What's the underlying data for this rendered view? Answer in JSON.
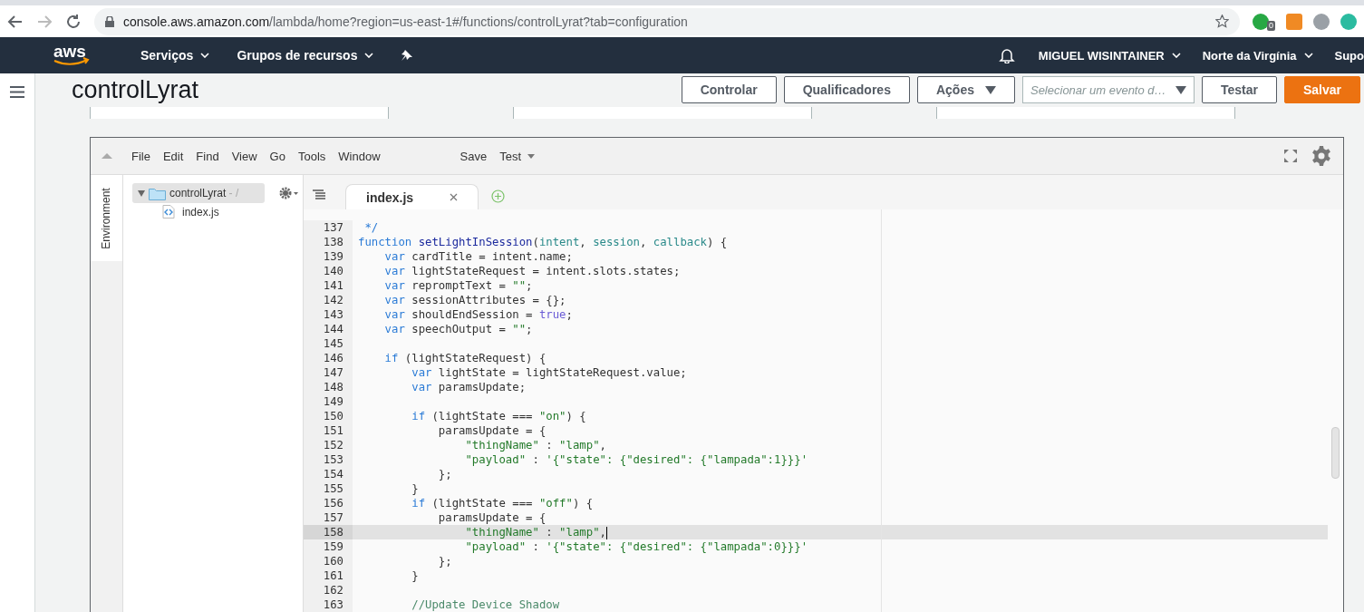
{
  "browser": {
    "url_host": "console.aws.amazon.com",
    "url_path": "/lambda/home?region=us-east-1#/functions/controlLyrat?tab=configuration",
    "extension_badge": "0"
  },
  "nav": {
    "logo": "aws",
    "items": [
      {
        "label": "Serviços"
      },
      {
        "label": "Grupos de recursos"
      }
    ],
    "user": "MIGUEL WISINTAINER",
    "region": "Norte da Virgínia",
    "support": "Supo"
  },
  "header": {
    "title": "controlLyrat",
    "buttons": [
      {
        "kind": "plain",
        "label": "Controlar"
      },
      {
        "kind": "plain",
        "label": "Qualificadores"
      },
      {
        "kind": "dropdown",
        "label": "Ações"
      },
      {
        "kind": "select",
        "placeholder": "Selecionar um evento d…"
      },
      {
        "kind": "plain",
        "label": "Testar"
      },
      {
        "kind": "primary",
        "label": "Salvar"
      }
    ]
  },
  "ide": {
    "menu": [
      "File",
      "Edit",
      "Find",
      "View",
      "Go",
      "Tools",
      "Window"
    ],
    "save": "Save",
    "test": "Test",
    "side_tab": "Environment",
    "tree": {
      "label": "controlLyrat",
      "suffix": "- /",
      "expanded": true,
      "children": [
        {
          "label": "index.js"
        }
      ]
    },
    "tabs": [
      {
        "label": "index.js",
        "selected": true
      }
    ],
    "lines": [
      {
        "number": "137",
        "current": false,
        "tokens": [
          {
            "kind": "comment",
            "text": " */"
          }
        ]
      },
      {
        "number": "138",
        "current": false,
        "tokens": [
          {
            "kind": "keyword",
            "text": "function "
          },
          {
            "kind": "func",
            "text": "setLightInSession"
          },
          {
            "kind": "plain",
            "text": "("
          },
          {
            "kind": "param",
            "text": "intent"
          },
          {
            "kind": "plain",
            "text": ", "
          },
          {
            "kind": "param",
            "text": "session"
          },
          {
            "kind": "plain",
            "text": ", "
          },
          {
            "kind": "param",
            "text": "callback"
          },
          {
            "kind": "plain",
            "text": ") {"
          }
        ]
      },
      {
        "number": "139",
        "current": false,
        "tokens": [
          {
            "kind": "keyword",
            "text": "    var "
          },
          {
            "kind": "plain",
            "text": "cardTitle = intent.name;"
          }
        ]
      },
      {
        "number": "140",
        "current": false,
        "tokens": [
          {
            "kind": "keyword",
            "text": "    var "
          },
          {
            "kind": "plain",
            "text": "lightStateRequest = intent.slots.states;"
          }
        ]
      },
      {
        "number": "141",
        "current": false,
        "tokens": [
          {
            "kind": "keyword",
            "text": "    var "
          },
          {
            "kind": "plain",
            "text": "repromptText = "
          },
          {
            "kind": "string",
            "text": "\"\""
          },
          {
            "kind": "plain",
            "text": ";"
          }
        ]
      },
      {
        "number": "142",
        "current": false,
        "tokens": [
          {
            "kind": "keyword",
            "text": "    var "
          },
          {
            "kind": "plain",
            "text": "sessionAttributes = {};"
          }
        ]
      },
      {
        "number": "143",
        "current": false,
        "tokens": [
          {
            "kind": "keyword",
            "text": "    var "
          },
          {
            "kind": "plain",
            "text": "shouldEndSession = "
          },
          {
            "kind": "literal",
            "text": "true"
          },
          {
            "kind": "plain",
            "text": ";"
          }
        ]
      },
      {
        "number": "144",
        "current": false,
        "tokens": [
          {
            "kind": "keyword",
            "text": "    var "
          },
          {
            "kind": "plain",
            "text": "speechOutput = "
          },
          {
            "kind": "string",
            "text": "\"\""
          },
          {
            "kind": "plain",
            "text": ";"
          }
        ]
      },
      {
        "number": "145",
        "current": false
      },
      {
        "number": "146",
        "current": false,
        "tokens": [
          {
            "kind": "keyword",
            "text": "    if "
          },
          {
            "kind": "plain",
            "text": "(lightStateRequest) {"
          }
        ]
      },
      {
        "number": "147",
        "current": false,
        "tokens": [
          {
            "kind": "keyword",
            "text": "        var "
          },
          {
            "kind": "plain",
            "text": "lightState = lightStateRequest.value;"
          }
        ]
      },
      {
        "number": "148",
        "current": false,
        "tokens": [
          {
            "kind": "keyword",
            "text": "        var "
          },
          {
            "kind": "plain",
            "text": "paramsUpdate;"
          }
        ]
      },
      {
        "number": "149",
        "current": false
      },
      {
        "number": "150",
        "current": false,
        "tokens": [
          {
            "kind": "keyword",
            "text": "        if "
          },
          {
            "kind": "plain",
            "text": "(lightState === "
          },
          {
            "kind": "string",
            "text": "\"on\""
          },
          {
            "kind": "plain",
            "text": ") {"
          }
        ]
      },
      {
        "number": "151",
        "current": false,
        "tokens": [
          {
            "kind": "plain",
            "text": "            paramsUpdate = {"
          }
        ]
      },
      {
        "number": "152",
        "current": false,
        "tokens": [
          {
            "kind": "string",
            "text": "                \"thingName\""
          },
          {
            "kind": "plain",
            "text": " : "
          },
          {
            "kind": "string",
            "text": "\"lamp\""
          },
          {
            "kind": "plain",
            "text": ","
          }
        ]
      },
      {
        "number": "153",
        "current": false,
        "tokens": [
          {
            "kind": "string",
            "text": "                \"payload\""
          },
          {
            "kind": "plain",
            "text": " : "
          },
          {
            "kind": "string",
            "text": "'{\"state\": {\"desired\": {\"lampada\":1}}}'"
          }
        ]
      },
      {
        "number": "154",
        "current": false,
        "tokens": [
          {
            "kind": "plain",
            "text": "            };"
          }
        ]
      },
      {
        "number": "155",
        "current": false,
        "tokens": [
          {
            "kind": "plain",
            "text": "        }"
          }
        ]
      },
      {
        "number": "156",
        "current": false,
        "tokens": [
          {
            "kind": "keyword",
            "text": "        if "
          },
          {
            "kind": "plain",
            "text": "(lightState === "
          },
          {
            "kind": "string",
            "text": "\"off\""
          },
          {
            "kind": "plain",
            "text": ") {"
          }
        ]
      },
      {
        "number": "157",
        "current": false,
        "tokens": [
          {
            "kind": "plain",
            "text": "            paramsUpdate = {"
          }
        ]
      },
      {
        "number": "158",
        "current": true,
        "tokens": [
          {
            "kind": "string",
            "text": "                \"thingName\""
          },
          {
            "kind": "plain",
            "text": " : "
          },
          {
            "kind": "string",
            "text": "\"lamp\""
          },
          {
            "kind": "plain",
            "text": ","
          }
        ]
      },
      {
        "number": "159",
        "current": false,
        "tokens": [
          {
            "kind": "string",
            "text": "                \"payload\""
          },
          {
            "kind": "plain",
            "text": " : "
          },
          {
            "kind": "string",
            "text": "'{\"state\": {\"desired\": {\"lampada\":0}}}'"
          }
        ]
      },
      {
        "number": "160",
        "current": false,
        "tokens": [
          {
            "kind": "plain",
            "text": "            };"
          }
        ]
      },
      {
        "number": "161",
        "current": false,
        "tokens": [
          {
            "kind": "plain",
            "text": "        }"
          }
        ]
      },
      {
        "number": "162",
        "current": false
      },
      {
        "number": "163",
        "current": false,
        "tokens": [
          {
            "kind": "linecomment",
            "text": "        //Update Device Shadow"
          }
        ]
      }
    ]
  }
}
